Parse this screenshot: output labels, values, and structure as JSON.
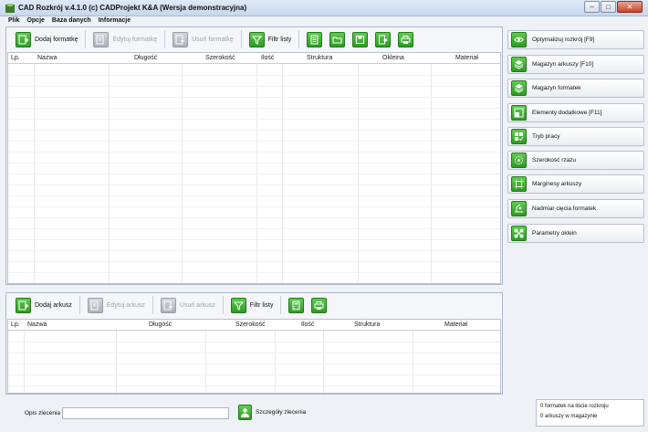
{
  "window": {
    "title": "CAD Rozkrój v.4.1.0  (c) CADProjekt K&A (Wersja demonstracyjna)",
    "icon": "app-logo-icon"
  },
  "menu": [
    "Plik",
    "Opcje",
    "Baza danych",
    "Informacje"
  ],
  "top_toolbar": {
    "add": "Dodaj formatkę",
    "edit": "Edytuj formatkę",
    "delete": "Usuń formatkę",
    "filter": "Filtr listy",
    "icons": [
      "list-icon",
      "folder-open-icon",
      "save-icon",
      "export-icon",
      "print-icon"
    ]
  },
  "formatki_table": {
    "columns": [
      "Lp.",
      "Nazwa",
      "Długość",
      "Szerokość",
      "Ilość",
      "Struktura",
      "Okleina",
      "Materiał"
    ],
    "rows": []
  },
  "bottom_toolbar": {
    "add": "Dodaj arkusz",
    "edit": "Edytuj arkusz",
    "delete": "Usuń arkusz",
    "filter": "Filtr listy",
    "icons": [
      "calculator-icon",
      "print-icon"
    ]
  },
  "arkusze_table": {
    "columns": [
      "Lp.",
      "Nazwa",
      "Długość",
      "Szerokość",
      "Ilość",
      "Struktura",
      "Materiał"
    ],
    "rows": []
  },
  "side_buttons": [
    {
      "label": "Optymalizuj rozkrój [F9]",
      "icon": "eye-icon"
    },
    {
      "label": "Magazyn arkuszy [F10]",
      "icon": "stack-icon"
    },
    {
      "label": "Magazyn formatek",
      "icon": "stack-icon"
    },
    {
      "label": "Elementy dodatkowe [F11]",
      "icon": "elements-icon"
    },
    {
      "label": "Tryb pracy",
      "icon": "mode-icon"
    },
    {
      "label": "Szerokość rzazu",
      "icon": "saw-blade-icon"
    },
    {
      "label": "Marginesy arkuszy",
      "icon": "margins-icon"
    },
    {
      "label": "Nadmiar cięcia formatek",
      "icon": "cut-excess-icon"
    },
    {
      "label": "Parametry oklein",
      "icon": "edging-params-icon"
    }
  ],
  "order": {
    "description_label": "Opis zlecenia",
    "description_value": "",
    "details_button": "Szczegóły zlecenia"
  },
  "status": {
    "line1": "0 formatek na liście rozkroju",
    "line2": "0 arkuszy w magazynie"
  },
  "colors": {
    "accent_green": "#2e9a25",
    "title_bar": "#c7d7ec"
  }
}
